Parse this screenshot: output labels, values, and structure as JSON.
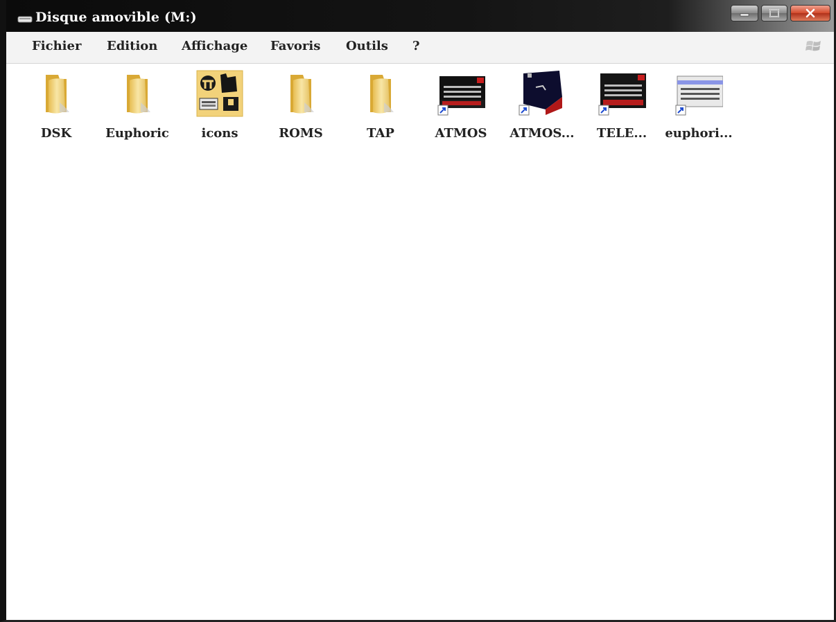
{
  "window": {
    "title": "Disque amovible (M:)",
    "icon": "removable-drive-icon",
    "controls": {
      "minimize": "minimize-icon",
      "maximize": "maximize-icon",
      "close": "close-icon",
      "close_color": "#d34a2c"
    }
  },
  "menubar": {
    "items": [
      {
        "label": "Fichier"
      },
      {
        "label": "Edition"
      },
      {
        "label": "Affichage"
      },
      {
        "label": "Favoris"
      },
      {
        "label": "Outils"
      },
      {
        "label": "?"
      }
    ],
    "logo": "windows-logo-icon"
  },
  "files": [
    {
      "label": "DSK",
      "type": "folder",
      "icon": "folder-icon"
    },
    {
      "label": "Euphoric",
      "type": "folder",
      "icon": "folder-icon"
    },
    {
      "label": "icons",
      "type": "folder",
      "icon": "icons-folder-thumbnail"
    },
    {
      "label": "ROMS",
      "type": "folder",
      "icon": "folder-icon"
    },
    {
      "label": "TAP",
      "type": "folder",
      "icon": "folder-icon"
    },
    {
      "label": "ATMOS",
      "type": "shortcut",
      "icon": "atmos-keyboard-shortcut-icon"
    },
    {
      "label": "ATMOS...",
      "type": "shortcut",
      "icon": "atmos-computer-shortcut-icon"
    },
    {
      "label": "TELE...",
      "type": "shortcut",
      "icon": "telestrat-keyboard-shortcut-icon"
    },
    {
      "label": "euphori...",
      "type": "shortcut",
      "icon": "euphoric-keyboard-shortcut-icon"
    }
  ],
  "colors": {
    "folder": "#f2d27a",
    "titlebar": "#111111",
    "menubar": "#f3f3f3",
    "keyboard_red": "#c81e1e",
    "keyboard_blue": "#8a95e6"
  }
}
